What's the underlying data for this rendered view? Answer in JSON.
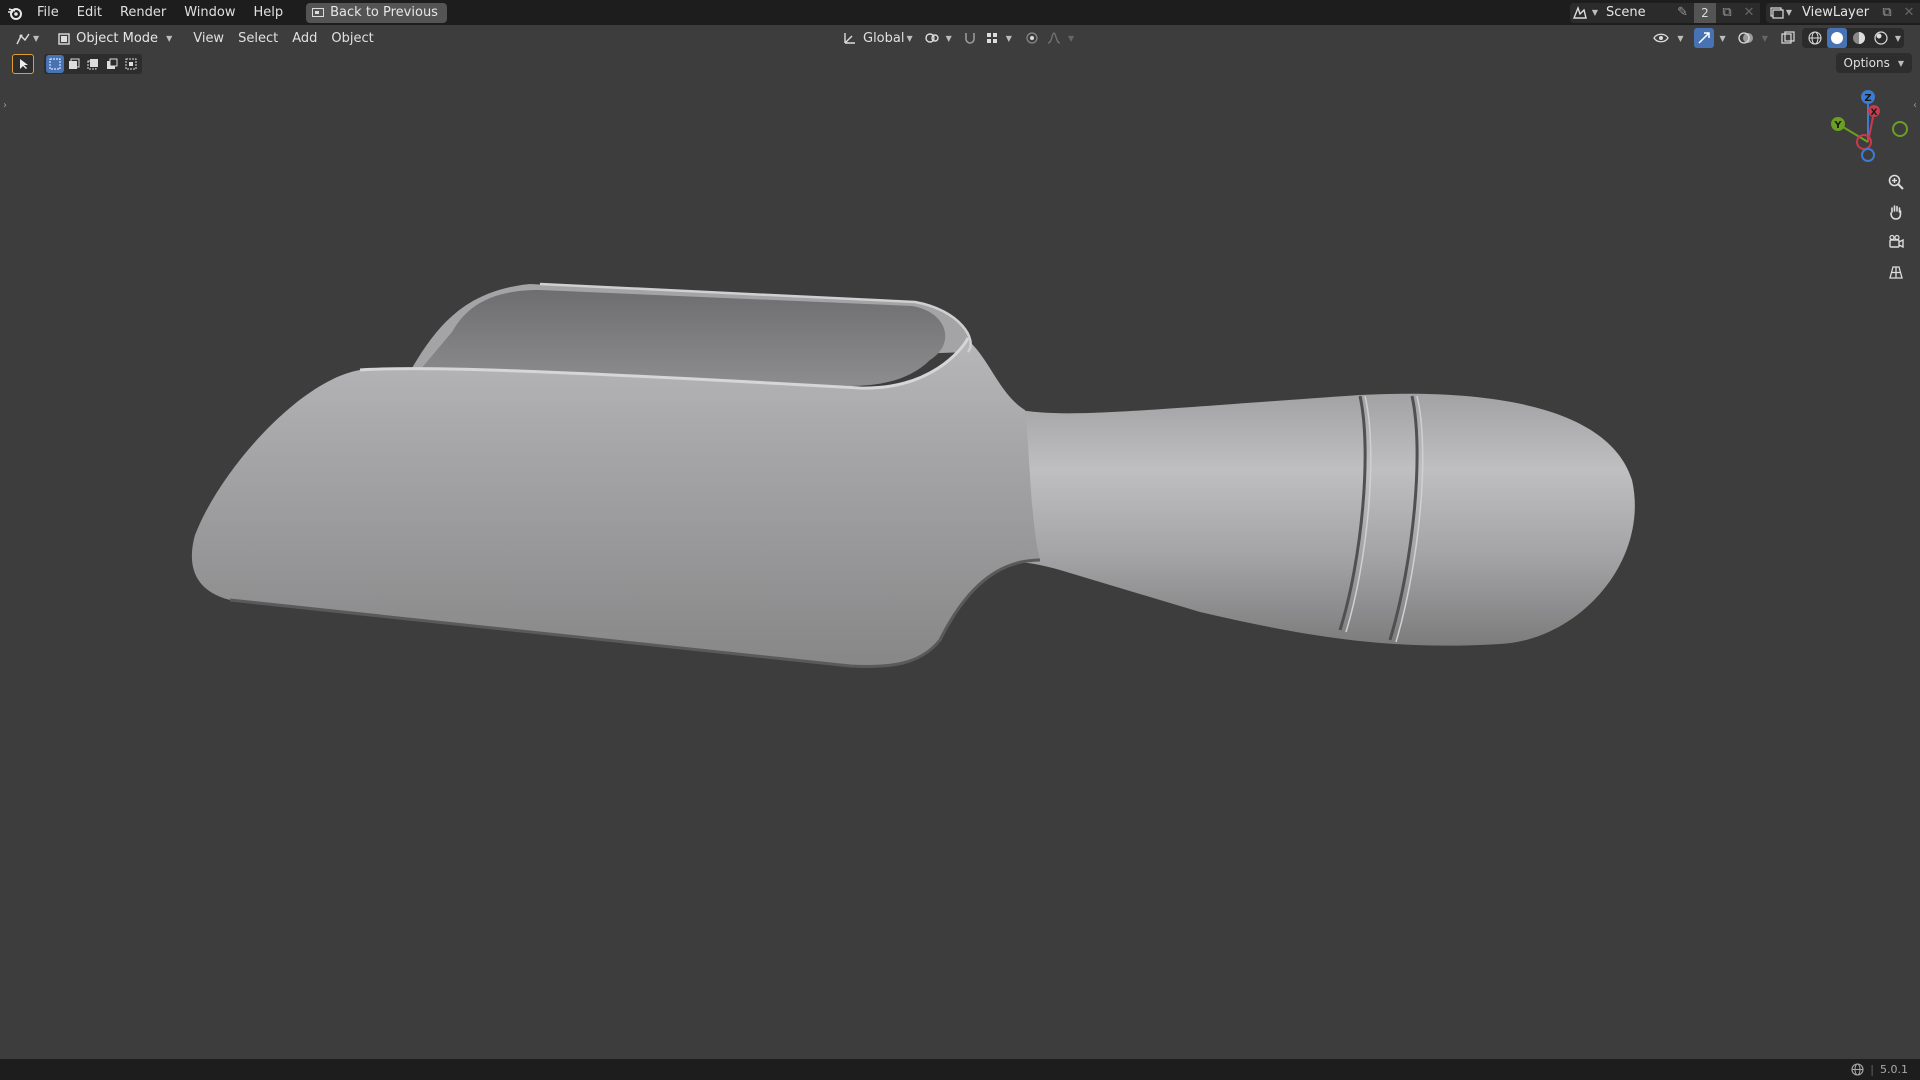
{
  "topbar": {
    "menu": [
      "File",
      "Edit",
      "Render",
      "Window",
      "Help"
    ],
    "back_label": "Back to Previous",
    "scene_name": "Scene",
    "scene_users": "2",
    "view_layer": "ViewLayer"
  },
  "header": {
    "mode_label": "Object Mode",
    "menus": [
      "View",
      "Select",
      "Add",
      "Object"
    ],
    "transform_orientation": "Global",
    "options_label": "Options"
  },
  "gizmo": {
    "z": "Z",
    "y": "Y",
    "x": "X"
  },
  "status": {
    "version": "5.0.1"
  },
  "colors": {
    "accent": "#4772b3",
    "x_axis": "#c93a4c",
    "y_axis": "#6b9f22",
    "z_axis": "#3d7bd0"
  }
}
